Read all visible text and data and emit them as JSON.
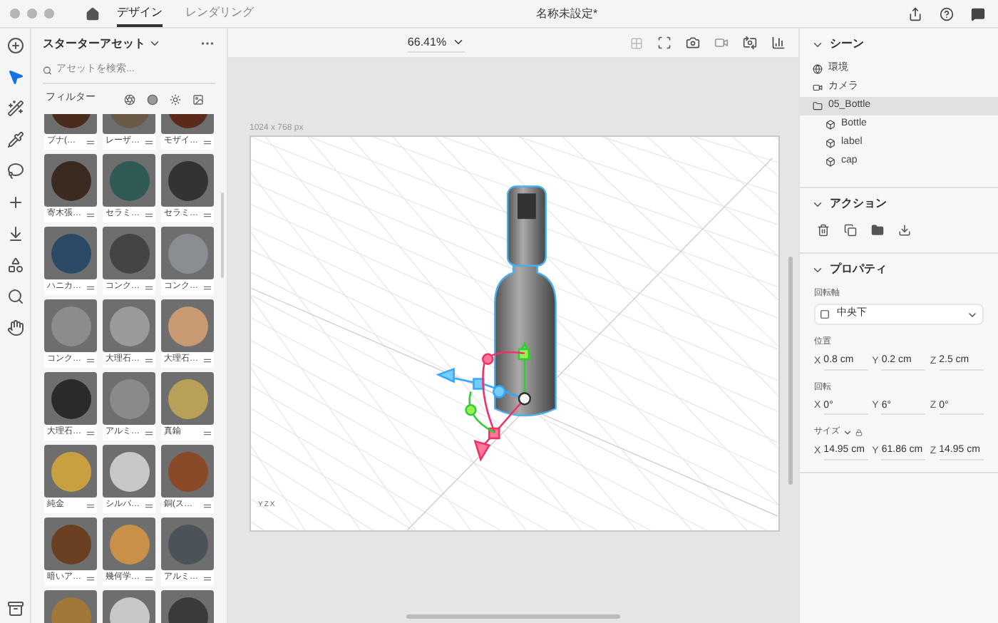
{
  "window": {
    "title": "名称未設定*"
  },
  "tabs": [
    {
      "label": "デザイン",
      "selected": true
    },
    {
      "label": "レンダリング",
      "selected": false
    }
  ],
  "tools": [
    {
      "kind": "add",
      "selected": false
    },
    {
      "kind": "select",
      "selected": true
    },
    {
      "kind": "wand",
      "selected": false
    },
    {
      "kind": "eyedropper",
      "selected": false
    },
    {
      "kind": "lasso",
      "selected": false
    },
    {
      "kind": "move",
      "selected": false
    },
    {
      "kind": "drop",
      "selected": false
    },
    {
      "kind": "perspective",
      "selected": false
    },
    {
      "kind": "zoom",
      "selected": false
    },
    {
      "kind": "hand",
      "selected": false
    }
  ],
  "assets": {
    "title": "スターターアセット",
    "search": {
      "placeholder": "アセットを検索..."
    },
    "filter_label": "フィルター",
    "swatches": [
      {
        "label": "ブナ(…",
        "color": "#4a2c1e"
      },
      {
        "label": "レーザ…",
        "color": "#6a5a48"
      },
      {
        "label": "モザイ…",
        "color": "#5a2a1a"
      },
      {
        "label": "寄木張…",
        "color": "#3a2a20"
      },
      {
        "label": "セラミ…",
        "color": "#2f5a55"
      },
      {
        "label": "セラミ…",
        "color": "#333333"
      },
      {
        "label": "ハニカ…",
        "color": "#2c4a66"
      },
      {
        "label": "コンク…",
        "color": "#444444"
      },
      {
        "label": "コンク…",
        "color": "#8a8e92"
      },
      {
        "label": "コンク…",
        "color": "#8c8c8c"
      },
      {
        "label": "大理石…",
        "color": "#9a9a9a"
      },
      {
        "label": "大理石…",
        "color": "#c89a72"
      },
      {
        "label": "大理石…",
        "color": "#2a2a2a"
      },
      {
        "label": "アルミ…",
        "color": "#8a8a8a"
      },
      {
        "label": "真鍮",
        "color": "#b8a058"
      },
      {
        "label": "純金",
        "color": "#c8a040"
      },
      {
        "label": "シルバ…",
        "color": "#c8c8c8"
      },
      {
        "label": "銅(ス…",
        "color": "#8a4a28"
      },
      {
        "label": "暗いア…",
        "color": "#6a4020"
      },
      {
        "label": "幾何学…",
        "color": "#c89048"
      },
      {
        "label": "アルミ…",
        "color": "#4a5458"
      },
      {
        "color": "#a07838"
      },
      {
        "color": "#c8c8c8"
      },
      {
        "color": "#3a3a3a"
      }
    ]
  },
  "canvas": {
    "zoom": "66.41%",
    "size_label": "1024 x 768 px",
    "axes": [
      "Y",
      "Z",
      "X"
    ]
  },
  "scene": {
    "title": "シーン",
    "expanded": true,
    "items": [
      {
        "label": "環境",
        "kind": "environment",
        "selected": false
      },
      {
        "label": "カメラ",
        "kind": "camera",
        "selected": false
      },
      {
        "label": "05_Bottle",
        "kind": "group",
        "selected": true,
        "children": [
          {
            "label": "Bottle",
            "kind": "mesh",
            "selected": false
          },
          {
            "label": "label",
            "kind": "mesh",
            "selected": false
          },
          {
            "label": "cap",
            "kind": "mesh",
            "selected": false
          }
        ]
      }
    ]
  },
  "actions": {
    "title": "アクション",
    "expanded": true
  },
  "properties": {
    "title": "プロパティ",
    "expanded": true,
    "pivot": {
      "label": "回転軸",
      "value": "中央下"
    },
    "groups": [
      {
        "label": "位置",
        "fields": [
          {
            "axis": "X",
            "value": "0.8 cm"
          },
          {
            "axis": "Y",
            "value": "0.2 cm"
          },
          {
            "axis": "Z",
            "value": "2.5 cm"
          }
        ]
      },
      {
        "label": "回転",
        "fields": [
          {
            "axis": "X",
            "value": "0°"
          },
          {
            "axis": "Y",
            "value": "6°"
          },
          {
            "axis": "Z",
            "value": "0°"
          }
        ]
      },
      {
        "label": "サイズ",
        "fields": [
          {
            "axis": "X",
            "value": "14.95 cm"
          },
          {
            "axis": "Y",
            "value": "61.86 cm"
          },
          {
            "axis": "Z",
            "value": "14.95 cm"
          }
        ]
      }
    ]
  }
}
